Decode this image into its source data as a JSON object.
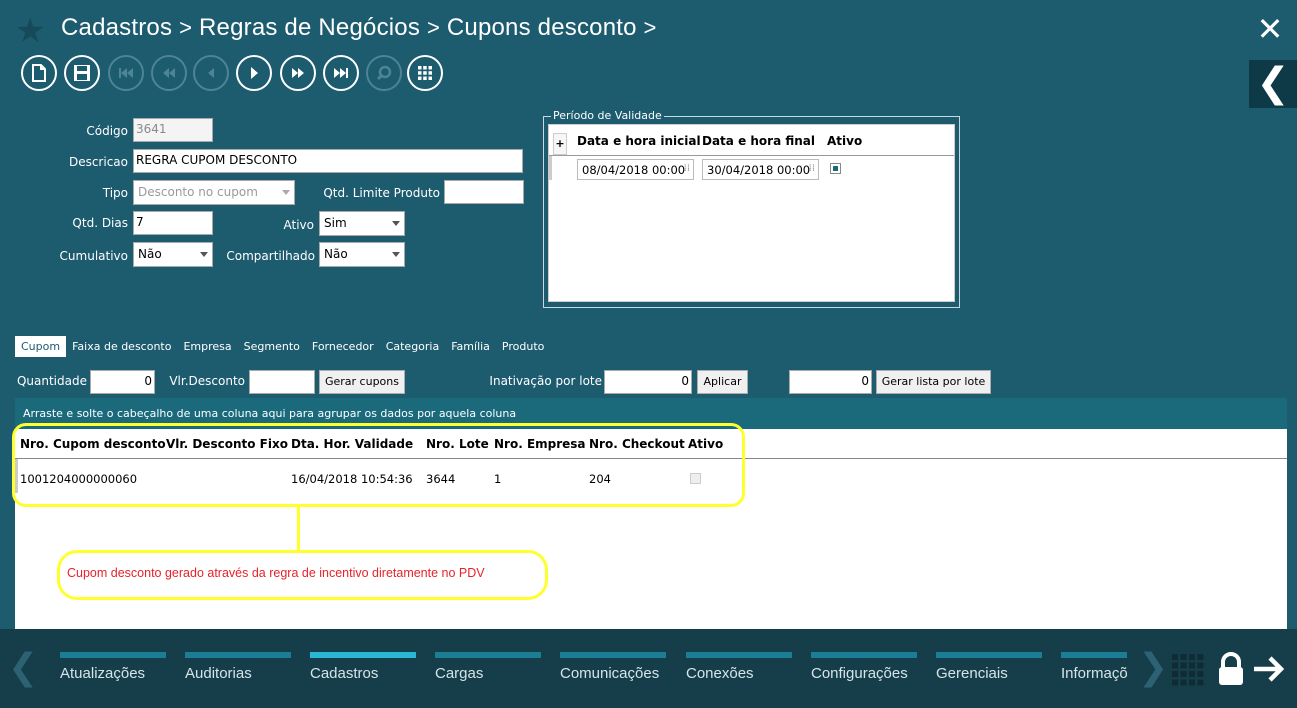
{
  "breadcrumb": {
    "items": [
      "Cadastros",
      "Regras de Negócios",
      "Cupons desconto"
    ],
    "sep": ">"
  },
  "form": {
    "codigo_label": "Código",
    "codigo_value": "3641",
    "descricao_label": "Descricao",
    "descricao_value": "REGRA CUPOM DESCONTO",
    "tipo_label": "Tipo",
    "tipo_value": "Desconto no cupom",
    "qtd_limite_label": "Qtd. Limite Produto",
    "qtd_limite_value": "",
    "qtd_dias_label": "Qtd. Dias",
    "qtd_dias_value": "7",
    "ativo_label": "Ativo",
    "ativo_value": "Sim",
    "cumulativo_label": "Cumulativo",
    "cumulativo_value": "Não",
    "compartilhado_label": "Compartilhado",
    "compartilhado_value": "Não"
  },
  "periodo": {
    "title": "Período de Validade",
    "add_symbol": "+",
    "columns": [
      "Data e hora inicial",
      "Data e hora final",
      "Ativo"
    ],
    "rows": [
      {
        "inicio": "08/04/2018 00:00",
        "fim": "30/04/2018 00:00",
        "ativo": true
      }
    ]
  },
  "tabs": [
    "Cupom",
    "Faixa de desconto",
    "Empresa",
    "Segmento",
    "Fornecedor",
    "Categoria",
    "Família",
    "Produto"
  ],
  "cupom_tab": {
    "quantidade_label": "Quantidade",
    "quantidade_value": "0",
    "vlr_desconto_label": "Vlr.Desconto",
    "vlr_desconto_value": "",
    "gerar_cupons": "Gerar cupons",
    "inativacao_label": "Inativação por lote",
    "inativacao_value": "0",
    "aplicar": "Aplicar",
    "lista_value": "0",
    "gerar_lista": "Gerar lista por lote"
  },
  "grid": {
    "group_hint": "Arraste e solte o cabeçalho de uma coluna aqui para agrupar os dados por aquela coluna",
    "columns": [
      "Nro. Cupom desconto",
      "Vlr. Desconto Fixo",
      "Dta. Hor. Validade",
      "Nro. Lote",
      "Nro. Empresa",
      "Nro. Checkout",
      "Ativo"
    ],
    "rows": [
      {
        "cupom": "1001204000000060",
        "vlr": "",
        "validade": "16/04/2018 10:54:36",
        "lote": "3644",
        "empresa": "1",
        "checkout": "204",
        "ativo": false
      }
    ]
  },
  "annotation": {
    "text": "Cupom desconto gerado através da regra de incentivo diretamente no PDV",
    "color": "#e8222a",
    "highlight_color": "#ffff2e"
  },
  "nav": {
    "items": [
      "Atualizações",
      "Auditorias",
      "Cadastros",
      "Cargas",
      "Comunicações",
      "Conexões",
      "Configurações",
      "Gerenciais",
      "Informações"
    ],
    "active": "Cadastros"
  },
  "icons": {
    "toolbar": [
      "new-document-icon",
      "save-icon",
      "first-record-icon",
      "rewind-icon",
      "previous-icon",
      "next-icon",
      "fast-forward-icon",
      "last-record-icon",
      "search-icon",
      "grid-menu-icon"
    ]
  },
  "colors": {
    "background": "#1d5b6e",
    "nav_background": "#163e4a",
    "nav_bar": "#1b7e95",
    "nav_bar_active": "#2cb6d6"
  }
}
